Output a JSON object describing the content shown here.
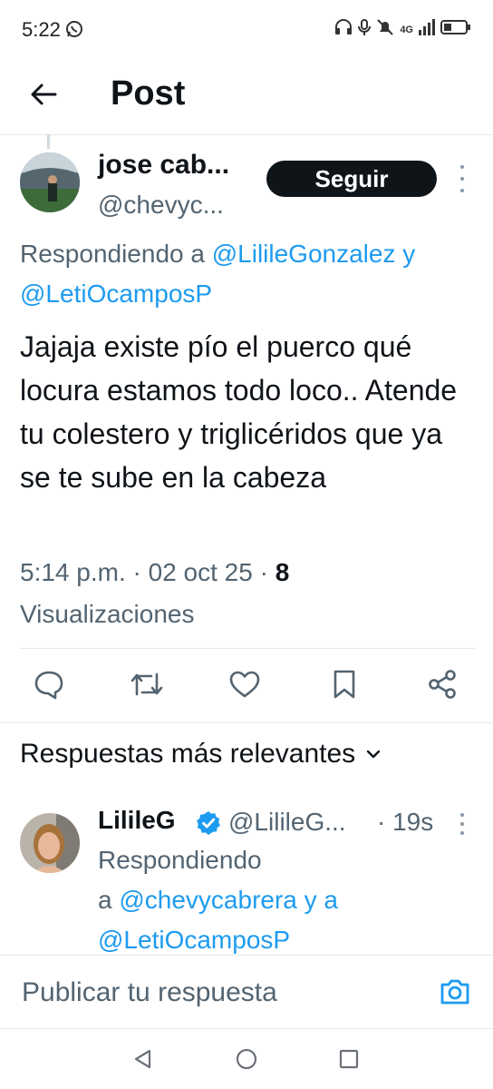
{
  "status_bar": {
    "time": "5:22",
    "network": "4G"
  },
  "header": {
    "title": "Post"
  },
  "post": {
    "author_name": "jose cab...",
    "author_handle": "@chevyc...",
    "follow_label": "Seguir",
    "replying_prefix": "Respondiendo a",
    "replying_user1": "@LilileGonzalez",
    "replying_conj": "y",
    "replying_user2": "@LetiOcamposP",
    "text": "Jajaja existe pío el puerco qué locura estamos todo loco.. Atende tu colestero y triglicéridos que ya se te sube en la cabeza",
    "time": "5:14 p.m.",
    "sep": "·",
    "date": "02 oct 25",
    "views_count": "8",
    "views_label": "Visualizaciones"
  },
  "actions": {
    "icons": [
      "reply-icon",
      "retweet-icon",
      "like-icon",
      "bookmark-icon",
      "share-icon"
    ]
  },
  "replies_sort": {
    "label": "Respuestas más relevantes"
  },
  "reply": {
    "name": "LilileG",
    "handle": "@LilileG...",
    "time": "· 19s",
    "replying_prefix": "Respondiendo",
    "replying_a": "a",
    "replying_user1": "@chevycabrera",
    "replying_conj": "y a",
    "replying_user2": "@LetiOcamposP"
  },
  "composer": {
    "placeholder": "Publicar tu respuesta"
  },
  "colors": {
    "link": "#1d9bf0",
    "text": "#0f1419",
    "muted": "#536471",
    "verified": "#1d9bf0"
  }
}
